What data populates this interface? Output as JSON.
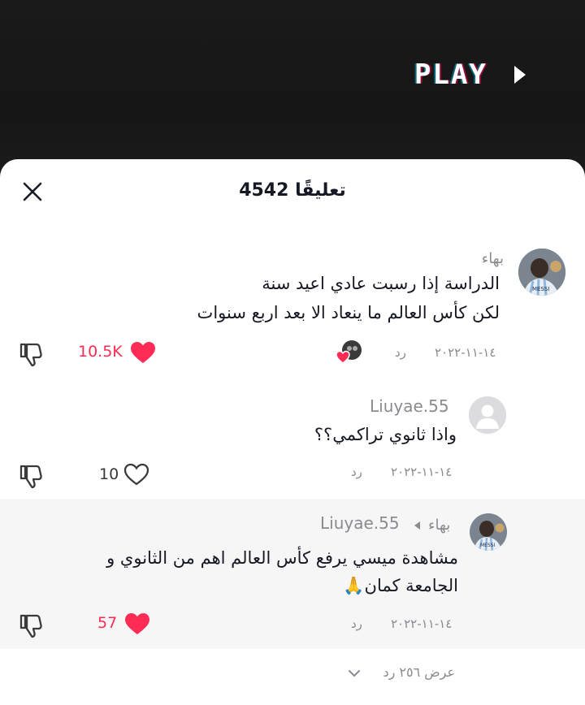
{
  "video": {
    "overlay_text": "PLAY"
  },
  "sheet": {
    "title": "4542 تعليقًا"
  },
  "comments": [
    {
      "author": "بهاء",
      "text_line1": "الدراسة إذا رسبت عادي اعيد سنة",
      "text_line2": "لكن كأس العالم ما ينعاد الا بعد اربع سنوات",
      "date": "١٤-١١-٢٠٢٢",
      "reply_label": "رد",
      "likes": "10.5K",
      "liked": true
    },
    {
      "author": "Liuyae.55",
      "text_line1": "واذا ثانوي تراكمي؟؟",
      "date": "١٤-١١-٢٠٢٢",
      "reply_label": "رد",
      "likes": "10",
      "liked": false
    }
  ],
  "reply": {
    "author": "بهاء",
    "reply_to": "Liuyae.55",
    "text_line1": "مشاهدة ميسي يرفع كأس العالم اهم من الثانوي و",
    "text_line2": "الجامعة كمان🙏",
    "date": "١٤-١١-٢٠٢٢",
    "reply_label": "رد",
    "likes": "57",
    "liked": true
  },
  "view_replies": "عرض ٢٥٦ رد",
  "colors": {
    "like_red": "#fe2c55",
    "muted_gray": "#8a8b91",
    "text": "#161823"
  },
  "icons": [
    "close-icon",
    "heart-icon",
    "dislike-icon",
    "chevron-down-icon",
    "play-icon"
  ]
}
